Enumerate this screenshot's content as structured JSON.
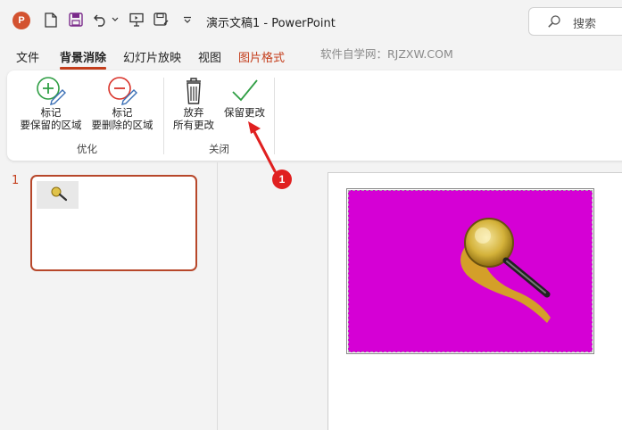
{
  "titlebar": {
    "app_logo": "P",
    "document_title": "演示文稿1  -  PowerPoint",
    "search_placeholder": "搜索"
  },
  "tabs": [
    {
      "label": "文件",
      "active": false
    },
    {
      "label": "背景消除",
      "active": true
    },
    {
      "label": "幻灯片放映",
      "active": false
    },
    {
      "label": "视图",
      "active": false
    },
    {
      "label": "图片格式",
      "active": false,
      "accent": true
    }
  ],
  "watermark": "软件自学网：RJZXW.COM",
  "ribbon": {
    "mark_keep": {
      "line1": "标记",
      "line2": "要保留的区域"
    },
    "mark_remove": {
      "line1": "标记",
      "line2": "要删除的区域"
    },
    "group_refine": "优化",
    "discard": {
      "line1": "放弃",
      "line2": "所有更改"
    },
    "keep_changes": {
      "line1": "保留更改"
    },
    "group_close": "关闭"
  },
  "slides_panel": {
    "slide_number": "1"
  },
  "annotation": {
    "badge_number": "1"
  },
  "colors": {
    "accent": "#c43e1c",
    "picture_background": "#d500d5",
    "annotation": "#e02020"
  }
}
